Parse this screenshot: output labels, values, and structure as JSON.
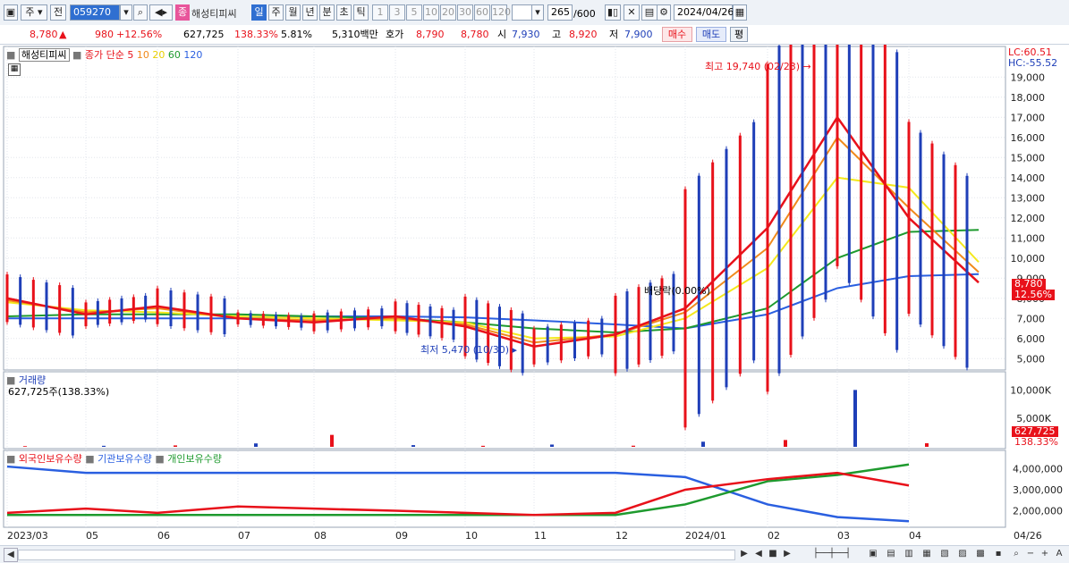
{
  "toolbar": {
    "market_select": "주",
    "prev_label": "전",
    "stock_code": "059270",
    "stock_name": "해성티피씨",
    "periods": [
      "일",
      "주",
      "월",
      "년",
      "분",
      "초",
      "틱"
    ],
    "active_period": "일",
    "intervals": [
      "1",
      "3",
      "5",
      "10",
      "20",
      "30",
      "60",
      "120"
    ],
    "count": "265",
    "max_count": "/600",
    "date": "2024/04/26"
  },
  "info": {
    "price": "8,780",
    "change": "980",
    "change_pct": "+12.56%",
    "volume": "627,725",
    "volume_ratio": "138.33%",
    "turnover": "5.81%",
    "amount": "5,310백만",
    "ask_label": "호가",
    "ask": "8,790",
    "bid": "8,780",
    "open_label": "시",
    "open": "7,930",
    "high_label": "고",
    "high": "8,920",
    "low_label": "저",
    "low": "7,900",
    "buy_label": "매수",
    "sell_label": "매도",
    "eval_label": "평"
  },
  "price_panel": {
    "name": "해성티피씨",
    "ma_title": "종가 단순",
    "ma_periods": [
      "5",
      "10",
      "20",
      "60",
      "120"
    ],
    "lc": "LC:60.51",
    "hc": "HC:-55.52",
    "high_annot": "최고 19,740 (02/23)",
    "low_annot": "최저 5,470 (10/30)",
    "div_annot": "배당락(0.00%)",
    "last_price": "8,780",
    "last_pct": "12.56%",
    "y_ticks": [
      "19,000",
      "18,000",
      "17,000",
      "16,000",
      "15,000",
      "14,000",
      "13,000",
      "12,000",
      "11,000",
      "10,000",
      "9,000",
      "8,000",
      "7,000",
      "6,000",
      "5,000"
    ]
  },
  "volume_panel": {
    "title": "거래량",
    "subtitle": "627,725주(138.33%)",
    "y_ticks": [
      "10,000K",
      "5,000K"
    ],
    "last_value": "627,725",
    "last_pct": "138.33%"
  },
  "holdings_panel": {
    "legend": [
      "외국인보유수량",
      "기관보유수량",
      "개인보유수량"
    ],
    "y_ticks": [
      "4,000,000",
      "3,000,000",
      "2,000,000"
    ]
  },
  "x_axis": {
    "labels": [
      "2023/03",
      "05",
      "06",
      "07",
      "08",
      "09",
      "10",
      "11",
      "12",
      "2024/01",
      "02",
      "03",
      "04"
    ],
    "end_label": "04/26"
  },
  "colors": {
    "up": "#e8111a",
    "down": "#1f3fb8",
    "ma5": "#e8111a",
    "ma10": "#f08a1c",
    "ma20": "#f4e81c",
    "ma60": "#1e9a2e",
    "ma120": "#2a5fe0"
  },
  "chart_data": {
    "type": "line",
    "x": [
      "2023/03",
      "05",
      "06",
      "07",
      "08",
      "09",
      "10",
      "11",
      "12",
      "2024/01",
      "02",
      "03",
      "04",
      "04/26"
    ],
    "series": [
      {
        "name": "5",
        "values": [
          8000,
          7200,
          7600,
          7000,
          6800,
          7100,
          6600,
          5600,
          6200,
          7500,
          11500,
          17000,
          12000,
          8780
        ]
      },
      {
        "name": "10",
        "values": [
          7900,
          7300,
          7500,
          7000,
          6900,
          7000,
          6700,
          5800,
          6200,
          7300,
          10500,
          16000,
          12500,
          9300
        ]
      },
      {
        "name": "20",
        "values": [
          7800,
          7400,
          7300,
          7100,
          7000,
          6900,
          6800,
          6000,
          6100,
          7000,
          9500,
          14000,
          13500,
          9800
        ]
      },
      {
        "name": "60",
        "values": [
          7100,
          7200,
          7200,
          7200,
          7100,
          7000,
          6800,
          6500,
          6300,
          6500,
          7500,
          10000,
          11300,
          11400
        ]
      },
      {
        "name": "120",
        "values": [
          7000,
          7000,
          7000,
          7000,
          7100,
          7100,
          7050,
          6900,
          6700,
          6500,
          7200,
          8500,
          9100,
          9200
        ]
      }
    ],
    "ylim": [
      5000,
      19740
    ],
    "volume": [
      120,
      180,
      250,
      600,
      2100,
      300,
      180,
      400,
      200,
      900,
      1200,
      10000,
      630
    ],
    "holdings_foreign": [
      1900000,
      2100000,
      1900000,
      2200000,
      2100000,
      2000000,
      1900000,
      1800000,
      1900000,
      3000000,
      3500000,
      3800000,
      3200000
    ],
    "holdings_institution": [
      4100000,
      3800000,
      3800000,
      3800000,
      3800000,
      3800000,
      3800000,
      3800000,
      3800000,
      3600000,
      2300000,
      1700000,
      1500000
    ],
    "holdings_individual": [
      1800000,
      1800000,
      1800000,
      1800000,
      1800000,
      1800000,
      1800000,
      1800000,
      1800000,
      2300000,
      3400000,
      3700000,
      4200000
    ]
  }
}
